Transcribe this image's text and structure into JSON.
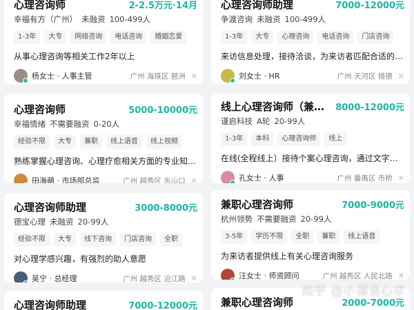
{
  "jobs": [
    {
      "title": "心理咨询师",
      "salary": "2-2.5万元·14月",
      "company": "幸福有方（广州）",
      "funding": "未融资",
      "size": "100-499人",
      "tags": [
        "1-3年",
        "大专",
        "网络咨询",
        "电话咨询",
        "婚姻恋爱"
      ],
      "desc": "从事心理咨询等相关工作2年以上",
      "recruiter": "杨女士 · 人事主管",
      "location": "广州  海珠区  琶洲",
      "avatar_color": "#9a8f86"
    },
    {
      "title": "心理咨询师助理",
      "salary": "7000-12000元",
      "company": "争渡咨询",
      "funding": "未融资",
      "size": "100-499人",
      "tags": [
        "1-3年",
        "大专",
        "心理咨询",
        "电话咨询",
        "门店咨询"
      ],
      "desc": "来访信息处理，接待洽谈，为来访者匹配合适的咨询师",
      "recruiter": "刘女士 · HR",
      "location": "广州  天河区  猎德",
      "avatar_color": "#c8b84a"
    },
    {
      "title": "心理咨询师",
      "salary": "5000-10000元",
      "company": "幸福情绪",
      "funding": "不需要融资",
      "size": "0-20人",
      "tags": [
        "经验不限",
        "大专",
        "兼职",
        "线上语音",
        "线上视频"
      ],
      "desc": "熟练掌握心理咨询、心理疗愈相关方面的专业知识，掌...",
      "recruiter": "田海萌 · 市场部总监",
      "location": "广州  越秀区  东山口",
      "avatar_color": "#d08a3c"
    },
    {
      "title": "线上心理咨询师（兼职/全...",
      "salary": "8000-12000元",
      "company": "谨启科技",
      "funding": "A轮",
      "size": "20-99人",
      "tags": [
        "1-3年",
        "本科",
        "心理咨询师",
        "线上"
      ],
      "desc": "在线(全程线上）接待个案心理咨询，通过文字、电话...",
      "recruiter": "孔女士 · 人事",
      "location": "广州  番禺区  市桥",
      "avatar_color": "#d98ca0"
    },
    {
      "title": "心理咨询师助理",
      "salary": "3000-8000元",
      "company": "德宝心理",
      "funding": "未融资",
      "size": "20-99人",
      "tags": [
        "经验不限",
        "大专",
        "线下咨询",
        "门店咨询",
        "全职"
      ],
      "desc": "对心理学感兴趣，有强烈的助人意愿",
      "recruiter": "吴宁 · 总经理",
      "location": "广州  越秀区  沿江路",
      "avatar_color": "#4a5d7a"
    },
    {
      "title": "兼职心理咨询师",
      "salary": "7000-9000元",
      "company": "杭州领势",
      "funding": "不需要融资",
      "size": "20-99人",
      "tags": [
        "3-5年",
        "学历不限",
        "全职",
        "兼职",
        "线上语音"
      ],
      "desc": "为来访者提供线上有关心理咨询服务",
      "recruiter": "汪女士 · 师资顾问",
      "location": "广州  越秀区  人民北路",
      "avatar_color": "#b0463a"
    },
    {
      "title": "心理咨询师助理",
      "salary": "7000-12000元"
    },
    {
      "title": "兼职心理咨询师",
      "salary": "2000-7000元"
    }
  ],
  "watermark": "知乎 @小谭谈心术"
}
